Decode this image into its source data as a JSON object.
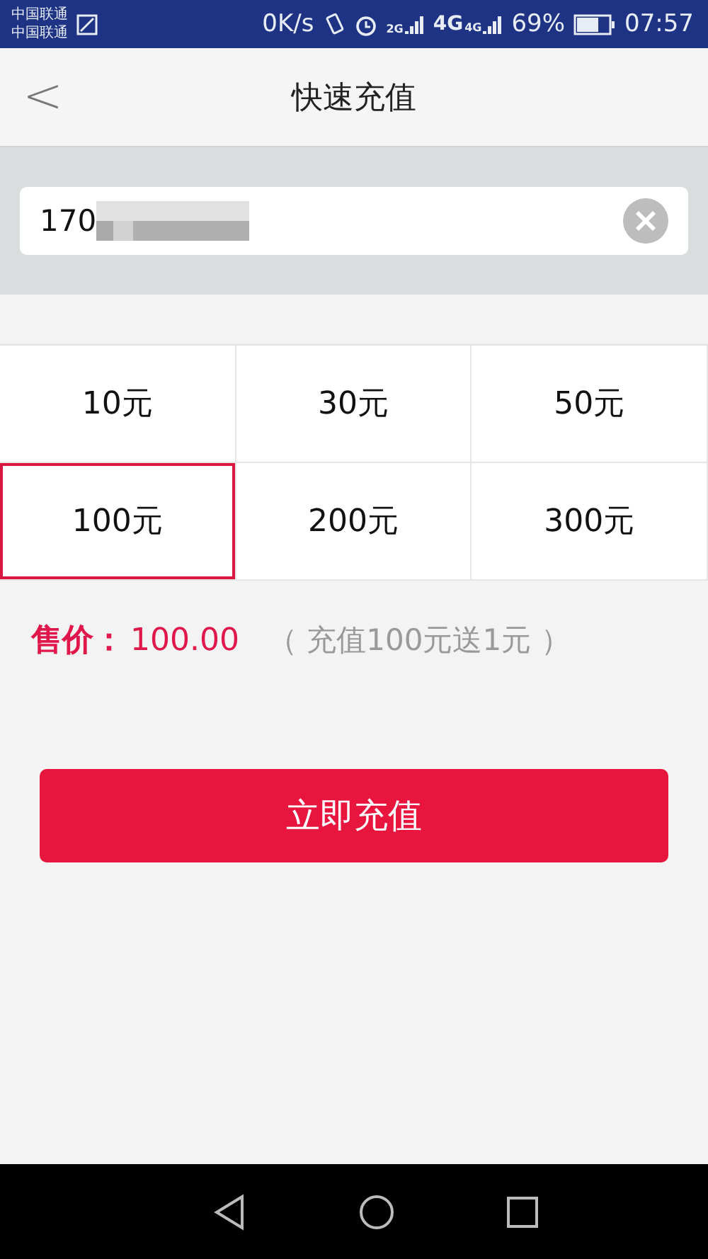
{
  "status_bar": {
    "carriers": [
      "中国联通",
      "中国联通"
    ],
    "speed": "0K/s",
    "signals": [
      {
        "label": "2G"
      },
      {
        "label": "4G",
        "extra": "4G"
      }
    ],
    "battery": "69%",
    "time": "07:57"
  },
  "header": {
    "back": "<",
    "title": "快速充值"
  },
  "phone_field": {
    "value": "170",
    "masked": true
  },
  "amounts": [
    {
      "label": "10元",
      "selected": false
    },
    {
      "label": "30元",
      "selected": false
    },
    {
      "label": "50元",
      "selected": false
    },
    {
      "label": "100元",
      "selected": true
    },
    {
      "label": "200元",
      "selected": false
    },
    {
      "label": "300元",
      "selected": false
    }
  ],
  "price": {
    "label": "售价：",
    "value": "100.00",
    "note": "（ 充值100元送1元 ）"
  },
  "submit": "立即充值"
}
